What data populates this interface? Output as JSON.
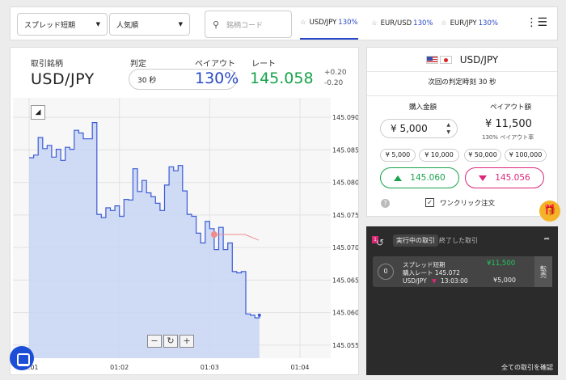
{
  "topbar": {
    "filter1": "スプレッド短期",
    "filter2": "人気順",
    "search_placeholder": "銘柄コード",
    "tabs": [
      {
        "pair": "USD/JPY",
        "pct": "130%"
      },
      {
        "pair": "EUR/USD",
        "pct": "130%"
      },
      {
        "pair": "EUR/JPY",
        "pct": "130%"
      }
    ]
  },
  "ticker": {
    "symbol_label": "取引銘柄",
    "symbol": "USD/JPY",
    "period_label": "判定",
    "period": "30 秒",
    "payout_label": "ペイアウト",
    "payout": "130%",
    "rate_label": "レート",
    "rate": "145.058",
    "change_up": "+0.20",
    "change_down": "-0.20"
  },
  "chart_data": {
    "type": "area",
    "y_ticks": [
      "145.090",
      "145.085",
      "145.080",
      "145.075",
      "145.070",
      "145.065",
      "145.060",
      "145.055"
    ],
    "x_ticks": [
      "01:01",
      "01:02",
      "01:03",
      "01:04"
    ],
    "ylim": [
      145.053,
      145.093
    ],
    "x": [
      0,
      0.05,
      0.1,
      0.15,
      0.2,
      0.25,
      0.3,
      0.35,
      0.4,
      0.45,
      0.5,
      0.55,
      0.6,
      0.65,
      0.7,
      0.75,
      0.8,
      0.85,
      0.9,
      0.95,
      1.0,
      1.05,
      1.1,
      1.15,
      1.2,
      1.25,
      1.3,
      1.35,
      1.4,
      1.45,
      1.5,
      1.55,
      1.6,
      1.65,
      1.7,
      1.75,
      1.8,
      1.85,
      1.9,
      1.95,
      2.0,
      2.05,
      2.1,
      2.15,
      2.2,
      2.25,
      2.3,
      2.35,
      2.4,
      2.45,
      2.5,
      2.55
    ],
    "values": [
      145.0838,
      145.0842,
      145.0869,
      145.0852,
      145.0857,
      145.0839,
      145.0851,
      145.0834,
      145.0854,
      145.0851,
      145.088,
      145.0876,
      145.0867,
      145.0867,
      145.0892,
      145.0751,
      145.0746,
      145.0761,
      145.0757,
      145.0764,
      145.0748,
      145.0774,
      145.0773,
      145.0821,
      145.0786,
      145.0803,
      145.0784,
      145.0778,
      145.0768,
      145.0757,
      145.0796,
      145.0824,
      145.0818,
      145.0826,
      145.0787,
      145.0751,
      145.0748,
      145.0722,
      145.0707,
      145.074,
      145.0729,
      145.0697,
      145.0731,
      145.0697,
      145.0707,
      145.0663,
      145.0661,
      145.0663,
      145.0598,
      145.0596,
      145.0592,
      145.0596
    ],
    "entry": {
      "x": 2.05,
      "rate": 145.072
    }
  },
  "zoom": {
    "minus": "−",
    "reset": "↻",
    "plus": "+"
  },
  "order": {
    "pair": "USD/JPY",
    "next_time": "次回の判定時刻 30 秒",
    "amount_label": "購入金額",
    "payout_label": "ペイアウト額",
    "amount": "¥ 5,000",
    "payout_amount": "¥ 11,500",
    "payout_rate": "130% ペイアウト率",
    "quick": [
      "¥ 5,000",
      "¥ 10,000",
      "¥ 50,000",
      "¥ 100,000"
    ],
    "high": "145.060",
    "low": "145.056",
    "oneclick": "ワンクリック注文"
  },
  "positions": {
    "badge": "1",
    "tab_active": "実行中の取引",
    "tab_closed": "終了した取引",
    "count": "0",
    "name": "スプレッド短期",
    "payout": "¥11,500",
    "entry_label": "購入レート 145.072",
    "pair": "USD/JPY",
    "time": "13:03:00",
    "stake": "¥5,000",
    "sell": "転売",
    "view_all": "全ての取引を確認"
  },
  "colors": {
    "accent": "#2848c8",
    "up": "#16a34a",
    "down": "#db2777",
    "area": "#c8d5f5",
    "line": "#3a5bd6"
  }
}
